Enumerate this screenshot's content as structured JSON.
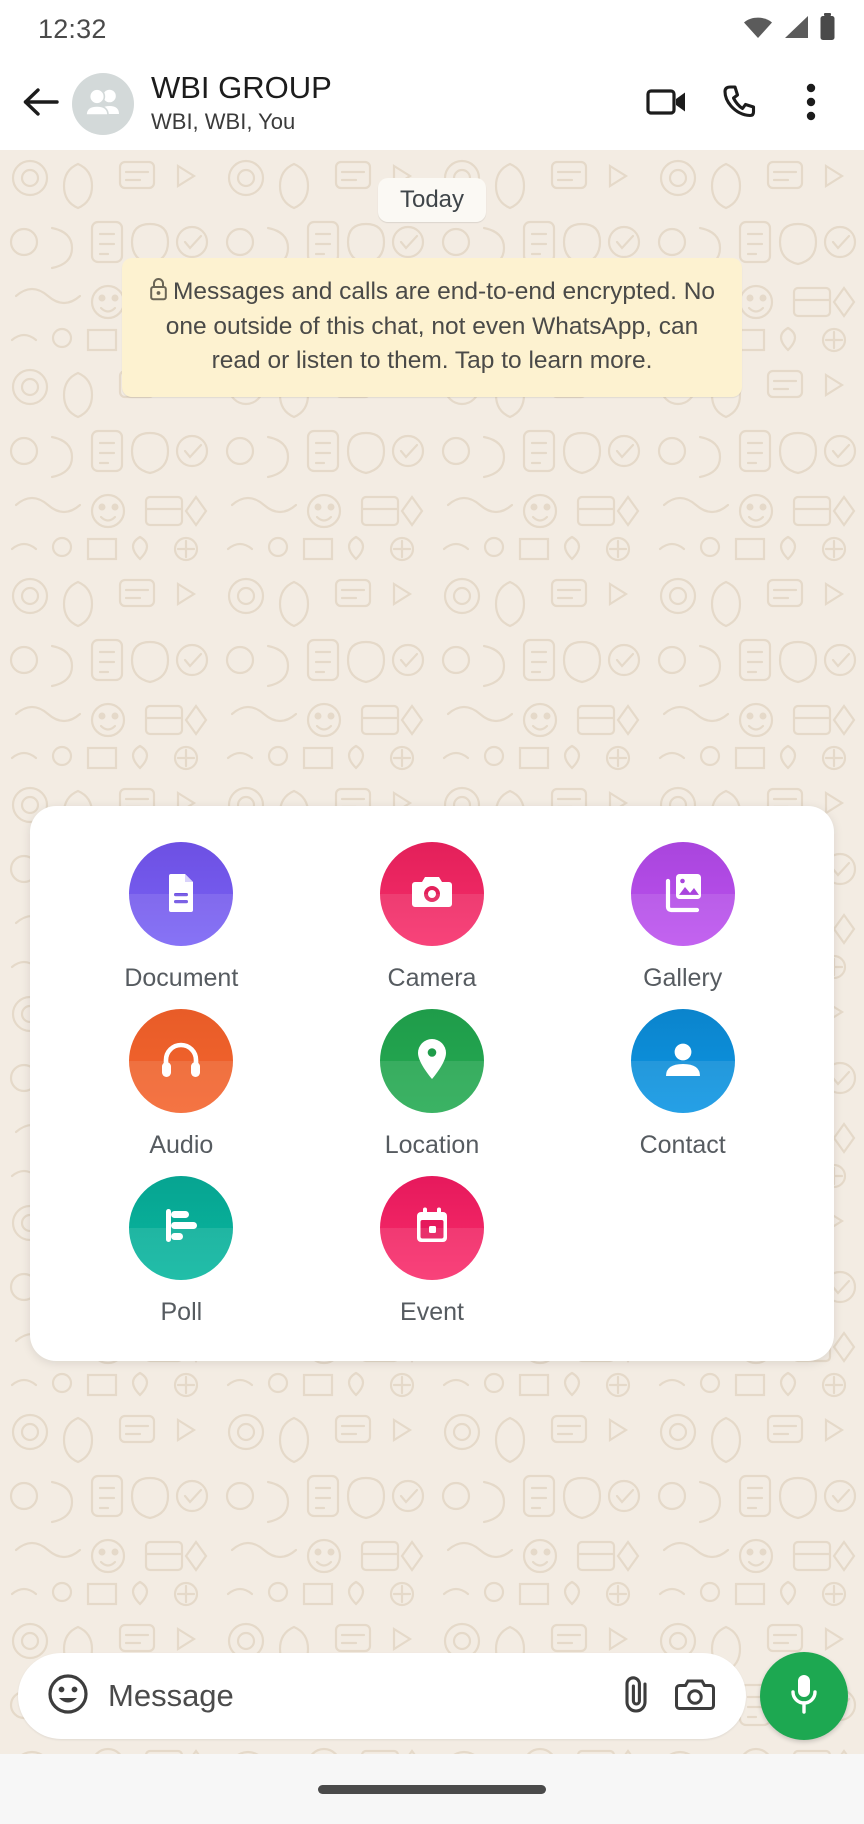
{
  "status_bar": {
    "time": "12:32",
    "icons": [
      "wifi-icon",
      "cellular-signal-icon",
      "battery-icon"
    ]
  },
  "header": {
    "back_icon": "back-arrow-icon",
    "avatar_icon": "group-avatar-icon",
    "title": "WBI GROUP",
    "subtitle": "WBI, WBI, You",
    "actions": [
      {
        "name": "video-call-button",
        "icon": "video-camera-icon"
      },
      {
        "name": "voice-call-button",
        "icon": "phone-icon"
      },
      {
        "name": "more-options-button",
        "icon": "overflow-menu-icon"
      }
    ]
  },
  "chat": {
    "day_divider": "Today",
    "encryption_notice": "Messages and calls are end-to-end encrypted. No one outside of this chat, not even WhatsApp, can read or listen to them. Tap to learn more.",
    "encryption_icon": "lock-icon",
    "background_color": "#f3ece3",
    "notice_color": "#fdf2d0"
  },
  "attachment_panel": {
    "items": [
      {
        "label": "Document",
        "icon": "document-icon",
        "color_start": "#6d50e3",
        "color_end": "#7a63f5"
      },
      {
        "label": "Camera",
        "icon": "camera-icon",
        "color_start": "#e3205a",
        "color_end": "#f72e6b"
      },
      {
        "label": "Gallery",
        "icon": "gallery-icon",
        "color_start": "#a945dd",
        "color_end": "#bc52ef"
      },
      {
        "label": "Audio",
        "icon": "headphones-icon",
        "color_start": "#e85c28",
        "color_end": "#f4652e"
      },
      {
        "label": "Location",
        "icon": "location-pin-icon",
        "color_start": "#1f9c4a",
        "color_end": "#25ab53"
      },
      {
        "label": "Contact",
        "icon": "person-icon",
        "color_start": "#0b84cc",
        "color_end": "#0d96e4"
      },
      {
        "label": "Poll",
        "icon": "poll-icon",
        "color_start": "#07a491",
        "color_end": "#08b79f"
      },
      {
        "label": "Event",
        "icon": "calendar-icon",
        "color_start": "#e6195c",
        "color_end": "#f92d6b"
      }
    ]
  },
  "input_bar": {
    "emoji_icon": "emoji-icon",
    "placeholder": "Message",
    "value": "",
    "attach_icon": "paperclip-icon",
    "camera_icon": "camera-outline-icon",
    "mic_icon": "microphone-icon",
    "mic_color": "#1da851"
  },
  "nav_bar": {
    "handle": "home-gesture-handle"
  }
}
